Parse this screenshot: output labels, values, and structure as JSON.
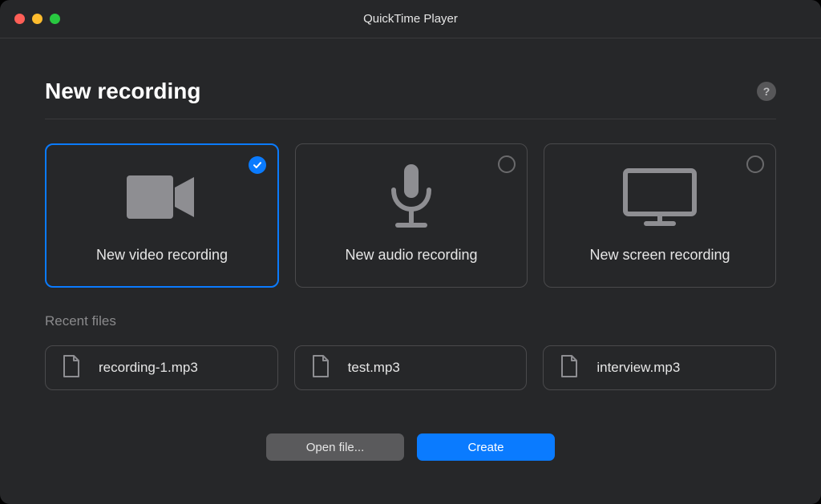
{
  "window": {
    "title": "QuickTime Player"
  },
  "main": {
    "heading": "New recording",
    "options": [
      {
        "label": "New video recording"
      },
      {
        "label": "New audio recording"
      },
      {
        "label": "New screen recording"
      }
    ],
    "recent_label": "Recent files",
    "recent_files": [
      {
        "name": "recording-1.mp3"
      },
      {
        "name": "test.mp3"
      },
      {
        "name": "interview.mp3"
      }
    ]
  },
  "footer": {
    "open_label": "Open file...",
    "create_label": "Create"
  }
}
